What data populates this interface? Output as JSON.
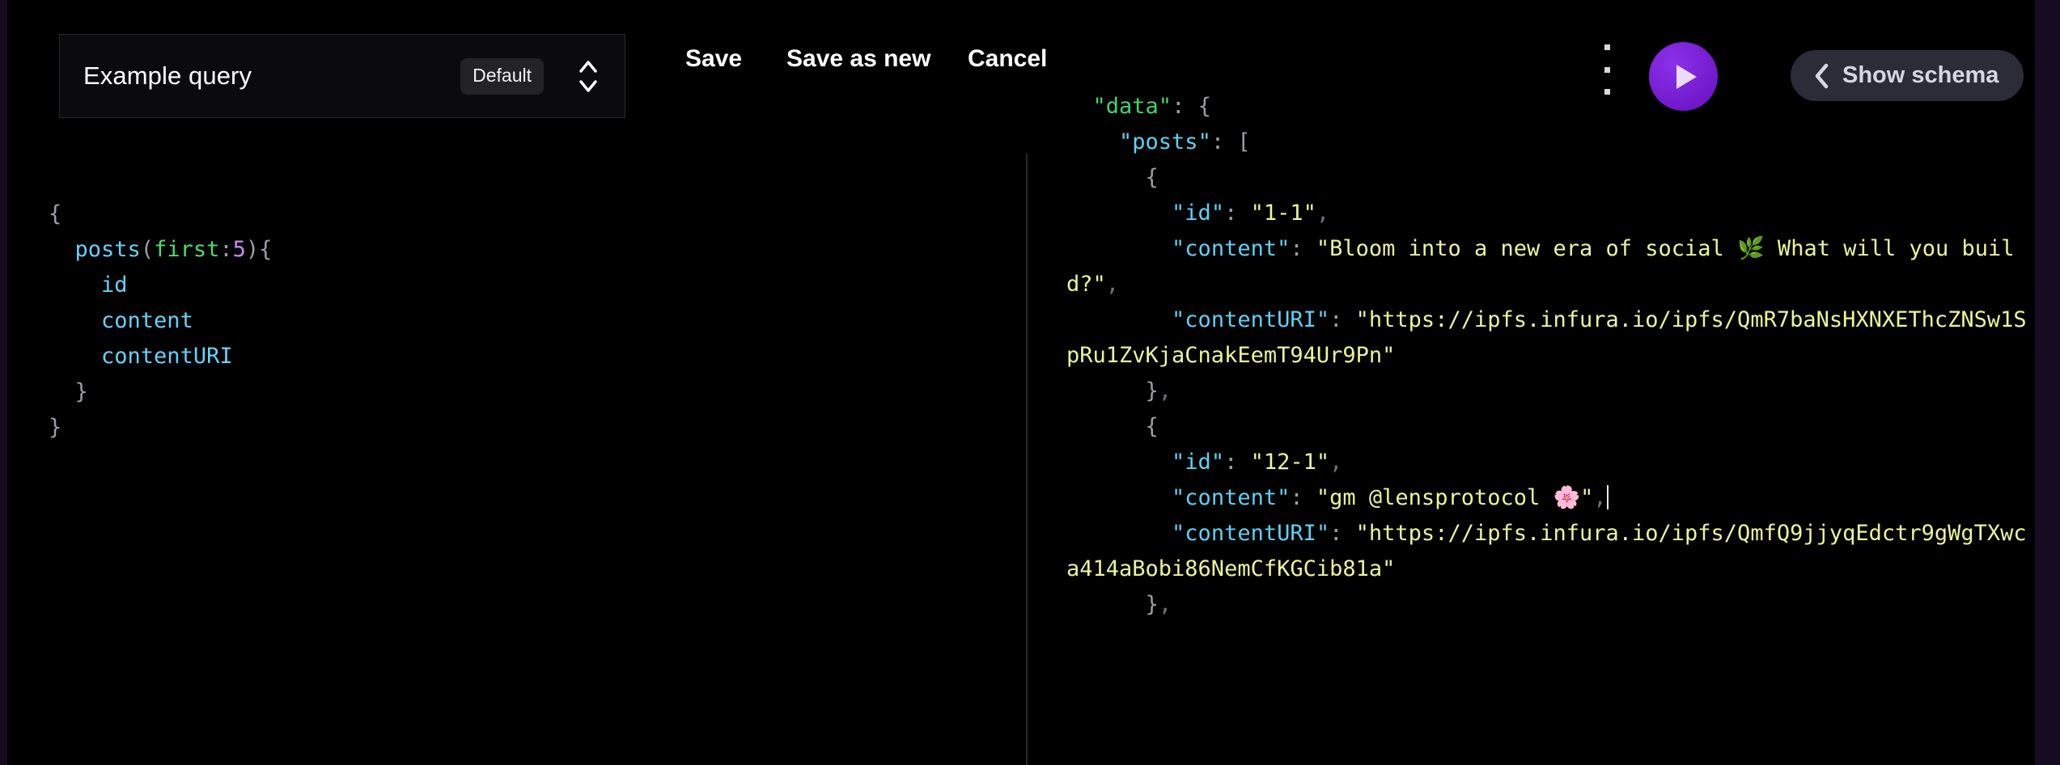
{
  "window": {
    "background": "#000000",
    "accent": "#7b1fd8"
  },
  "toolbar": {
    "query_name": "Example query",
    "default_badge": "Default",
    "stepper_icon": "chevron-up-down-icon",
    "save_label": "Save",
    "save_as_new_label": "Save as new",
    "cancel_label": "Cancel",
    "kebab_icon": "more-vertical-icon",
    "run_icon": "play-icon",
    "show_schema_label": "Show schema",
    "show_schema_icon": "chevron-left-icon"
  },
  "editor": {
    "language": "graphql",
    "lines": [
      {
        "indent": 0,
        "tokens": [
          {
            "t": "{",
            "c": "punct"
          }
        ]
      },
      {
        "indent": 1,
        "tokens": [
          {
            "t": "posts",
            "c": "field"
          },
          {
            "t": "(",
            "c": "punct"
          },
          {
            "t": "first",
            "c": "arg"
          },
          {
            "t": ":",
            "c": "punct"
          },
          {
            "t": "5",
            "c": "num"
          },
          {
            "t": ")",
            "c": "punct"
          },
          {
            "t": "{",
            "c": "punct"
          }
        ]
      },
      {
        "indent": 2,
        "tokens": [
          {
            "t": "id",
            "c": "field"
          }
        ]
      },
      {
        "indent": 2,
        "tokens": [
          {
            "t": "content",
            "c": "field"
          }
        ]
      },
      {
        "indent": 2,
        "tokens": [
          {
            "t": "contentURI",
            "c": "field"
          }
        ]
      },
      {
        "indent": 1,
        "tokens": [
          {
            "t": "}",
            "c": "punct"
          }
        ]
      },
      {
        "indent": 0,
        "tokens": [
          {
            "t": "}",
            "c": "punct"
          }
        ]
      }
    ]
  },
  "result": {
    "lines": [
      {
        "indent": 1,
        "tokens": [
          {
            "t": "\"data\"",
            "c": "data"
          },
          {
            "t": ":",
            "c": "punct"
          },
          {
            "t": " {",
            "c": "punct"
          }
        ]
      },
      {
        "indent": 2,
        "tokens": [
          {
            "t": "\"posts\"",
            "c": "key"
          },
          {
            "t": ":",
            "c": "punct"
          },
          {
            "t": " [",
            "c": "punct"
          }
        ]
      },
      {
        "indent": 3,
        "tokens": [
          {
            "t": "{",
            "c": "punct"
          }
        ]
      },
      {
        "indent": 4,
        "tokens": [
          {
            "t": "\"id\"",
            "c": "key"
          },
          {
            "t": ":",
            "c": "punct"
          },
          {
            "t": " ",
            "c": "punct"
          },
          {
            "t": "\"1-1\"",
            "c": "str"
          },
          {
            "t": ",",
            "c": "comma"
          }
        ]
      },
      {
        "indent": 4,
        "wrap": true,
        "tokens": [
          {
            "t": "\"content\"",
            "c": "key"
          },
          {
            "t": ":",
            "c": "punct"
          },
          {
            "t": " ",
            "c": "punct"
          },
          {
            "t": "\"Bloom into a new era of social 🌿 What will you build?\"",
            "c": "str"
          },
          {
            "t": ",",
            "c": "comma"
          }
        ]
      },
      {
        "indent": 4,
        "wrap": true,
        "tokens": [
          {
            "t": "\"contentURI\"",
            "c": "key"
          },
          {
            "t": ":",
            "c": "punct"
          },
          {
            "t": " ",
            "c": "punct"
          },
          {
            "t": "\"https://ipfs.infura.io/ipfs/QmR7baNsHXNXEThcZNSw1SpRu1ZvKjaCnakEemT94Ur9Pn\"",
            "c": "str"
          }
        ]
      },
      {
        "indent": 3,
        "tokens": [
          {
            "t": "}",
            "c": "punct"
          },
          {
            "t": ",",
            "c": "comma"
          }
        ]
      },
      {
        "indent": 3,
        "tokens": [
          {
            "t": "{",
            "c": "punct"
          }
        ]
      },
      {
        "indent": 4,
        "tokens": [
          {
            "t": "\"id\"",
            "c": "key"
          },
          {
            "t": ":",
            "c": "punct"
          },
          {
            "t": " ",
            "c": "punct"
          },
          {
            "t": "\"12-1\"",
            "c": "str"
          },
          {
            "t": ",",
            "c": "comma"
          }
        ]
      },
      {
        "indent": 4,
        "caret": true,
        "tokens": [
          {
            "t": "\"content\"",
            "c": "key"
          },
          {
            "t": ":",
            "c": "punct"
          },
          {
            "t": " ",
            "c": "punct"
          },
          {
            "t": "\"gm @lensprotocol 🌸\"",
            "c": "str"
          },
          {
            "t": ",",
            "c": "comma"
          }
        ]
      },
      {
        "indent": 4,
        "wrap": true,
        "tokens": [
          {
            "t": "\"contentURI\"",
            "c": "key"
          },
          {
            "t": ":",
            "c": "punct"
          },
          {
            "t": " ",
            "c": "punct"
          },
          {
            "t": "\"https://ipfs.infura.io/ipfs/QmfQ9jjyqEdctr9gWgTXwca414aBobi86NemCfKGCib81a\"",
            "c": "str"
          }
        ]
      },
      {
        "indent": 3,
        "tokens": [
          {
            "t": "}",
            "c": "punct"
          },
          {
            "t": ",",
            "c": "comma"
          }
        ]
      }
    ]
  }
}
